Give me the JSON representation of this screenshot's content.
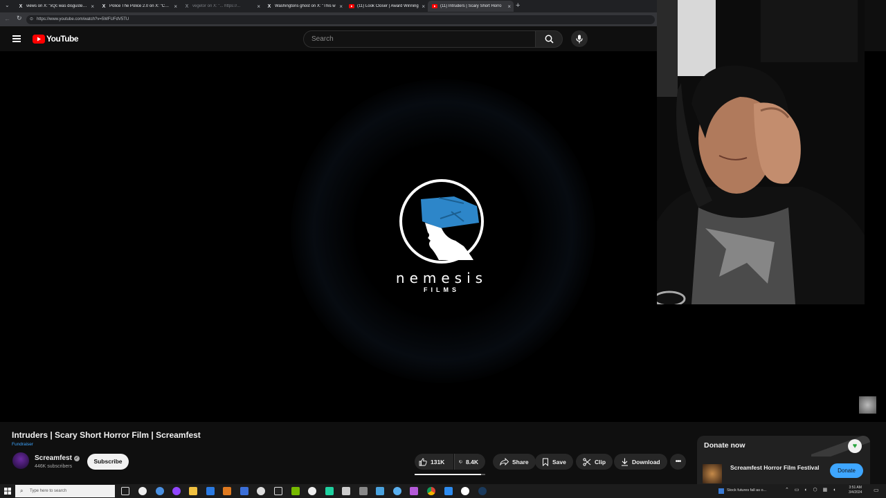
{
  "browser": {
    "tabs": [
      {
        "title": "views on X: \"xQc was disgusted ar",
        "icon": "x-logo-icon",
        "active": false
      },
      {
        "title": "Police The Police 2.0 on X: \"Cop B",
        "icon": "x-logo-icon",
        "active": false
      },
      {
        "title": "vegetor on X: \"... https://...",
        "icon": "x-logo-icon",
        "active": false,
        "dimmed": true
      },
      {
        "title": "Washingtons ghost on X: \"This w",
        "icon": "x-logo-icon",
        "active": false
      },
      {
        "title": "(11) Look Closer | Award Winning",
        "icon": "youtube-favicon-icon",
        "active": false
      },
      {
        "title": "(11) Intruders | Scary Short Horro",
        "icon": "youtube-favicon-icon",
        "active": true
      }
    ],
    "url": "https://www.youtube.com/watch?v=5WFUFdV5TU"
  },
  "youtube": {
    "logo_text": "YouTube",
    "search_placeholder": "Search"
  },
  "video": {
    "logo_name": "nemesis",
    "logo_sub": "FILMS"
  },
  "meta": {
    "title": "Intruders | Scary Short Horror Film | Screamfest",
    "fundraiser_label": "Fundraiser",
    "channel_name": "Screamfest",
    "subscribers": "446K subscribers",
    "subscribe_label": "Subscribe"
  },
  "actions": {
    "likes": "131K",
    "dislikes": "8.4K",
    "like_ratio": 0.94,
    "share": "Share",
    "save": "Save",
    "clip": "Clip",
    "download": "Download"
  },
  "donate": {
    "heading": "Donate now",
    "org": "Screamfest Horror Film Festival",
    "button": "Donate"
  },
  "taskbar": {
    "search_placeholder": "Type here to search",
    "news": "Stock futures fall as o...",
    "time": "3:51 AM",
    "date": "3/4/2024"
  },
  "colors": {
    "yt_red": "#ff0000",
    "accent_blue": "#3ea6ff",
    "logo_blue": "#2d86c9"
  }
}
